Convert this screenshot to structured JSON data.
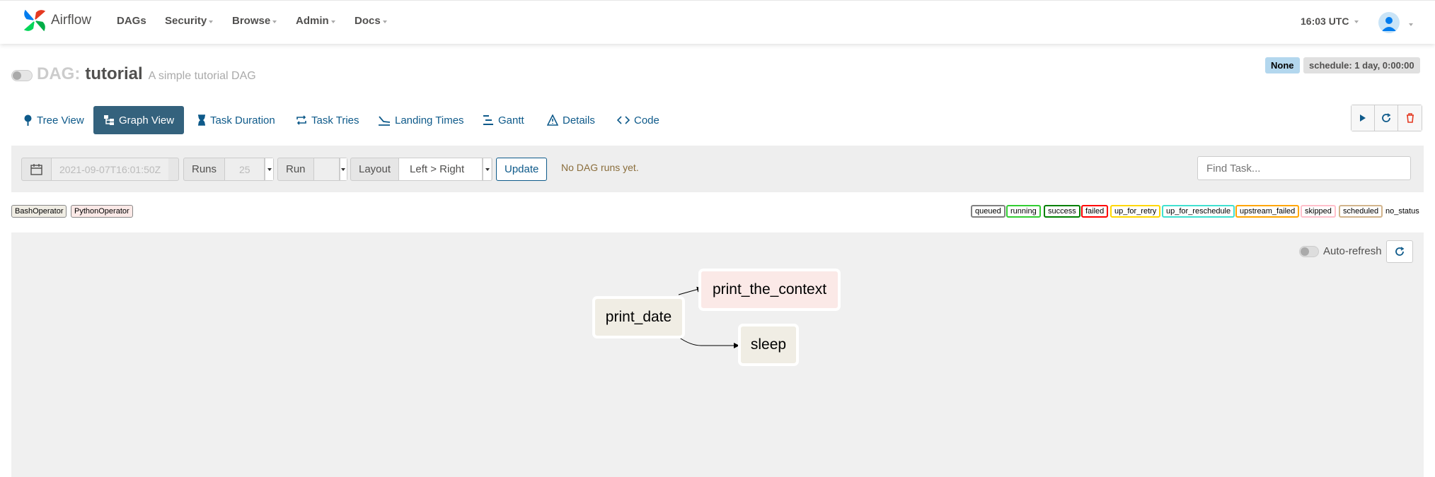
{
  "app": {
    "brand": "Airflow"
  },
  "nav": {
    "items": [
      {
        "label": "DAGs"
      },
      {
        "label": "Security"
      },
      {
        "label": "Browse"
      },
      {
        "label": "Admin"
      },
      {
        "label": "Docs"
      }
    ],
    "time": "16:03 UTC"
  },
  "dag": {
    "prefix": "DAG:",
    "id": "tutorial",
    "description": "A simple tutorial DAG",
    "badge_none": "None",
    "schedule": "schedule: 1 day, 0:00:00"
  },
  "tabs": [
    {
      "label": "Tree View",
      "icon": "tree-icon"
    },
    {
      "label": "Graph View",
      "icon": "graph-icon",
      "active": true
    },
    {
      "label": "Task Duration",
      "icon": "hourglass-icon"
    },
    {
      "label": "Task Tries",
      "icon": "repeat-icon"
    },
    {
      "label": "Landing Times",
      "icon": "landing-icon"
    },
    {
      "label": "Gantt",
      "icon": "gantt-icon"
    },
    {
      "label": "Details",
      "icon": "warning-triangle-icon"
    },
    {
      "label": "Code",
      "icon": "code-icon"
    }
  ],
  "filter": {
    "date_placeholder": "2021-09-07T16:01:50Z",
    "runs_label": "Runs",
    "runs_value": "25",
    "run_label": "Run",
    "run_value": "",
    "layout_label": "Layout",
    "layout_value": "Left > Right",
    "update_label": "Update",
    "no_runs": "No DAG runs yet.",
    "find_task_placeholder": "Find Task..."
  },
  "operators": [
    {
      "label": "BashOperator",
      "color": "#f0ede4"
    },
    {
      "label": "PythonOperator",
      "color": "#fbe9e7"
    }
  ],
  "states": [
    {
      "label": "queued",
      "color": "#808080"
    },
    {
      "label": "running",
      "color": "#32cd32"
    },
    {
      "label": "success",
      "color": "#008000"
    },
    {
      "label": "failed",
      "color": "#ff0000"
    },
    {
      "label": "up_for_retry",
      "color": "#ffd700"
    },
    {
      "label": "up_for_reschedule",
      "color": "#40e0d0"
    },
    {
      "label": "upstream_failed",
      "color": "#ffa500"
    },
    {
      "label": "skipped",
      "color": "#ffc0cb"
    },
    {
      "label": "scheduled",
      "color": "#d2b48c"
    }
  ],
  "no_status": "no_status",
  "graph": {
    "auto_refresh_label": "Auto-refresh",
    "nodes": [
      {
        "id": "print_date",
        "operator": "BashOperator"
      },
      {
        "id": "print_the_context",
        "operator": "PythonOperator"
      },
      {
        "id": "sleep",
        "operator": "BashOperator"
      }
    ]
  }
}
